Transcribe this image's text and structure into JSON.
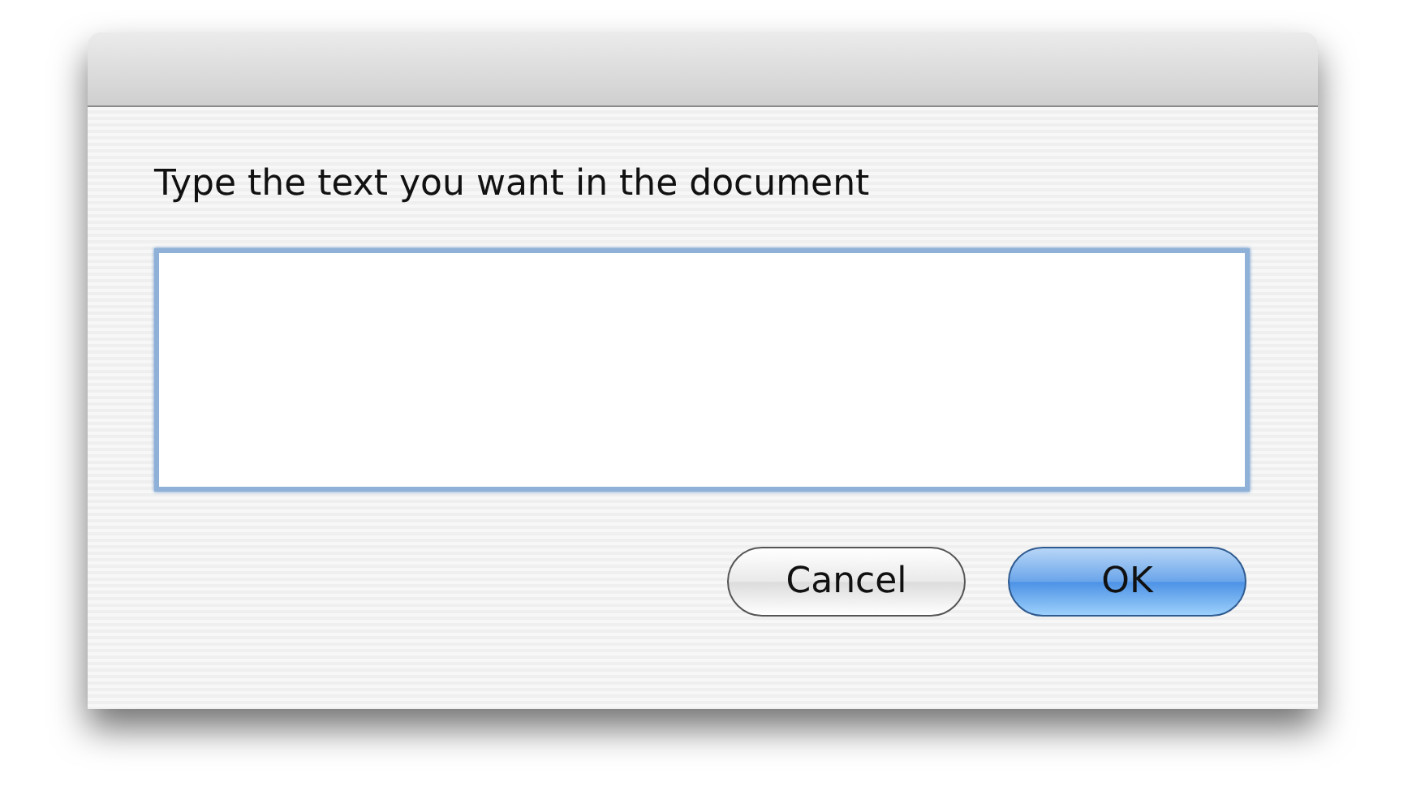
{
  "dialog": {
    "prompt": "Type the text you want in the document",
    "field": {
      "focused": true
    },
    "buttons": [
      {
        "label": "Cancel",
        "default": false
      },
      {
        "label": "OK",
        "default": true
      }
    ]
  }
}
